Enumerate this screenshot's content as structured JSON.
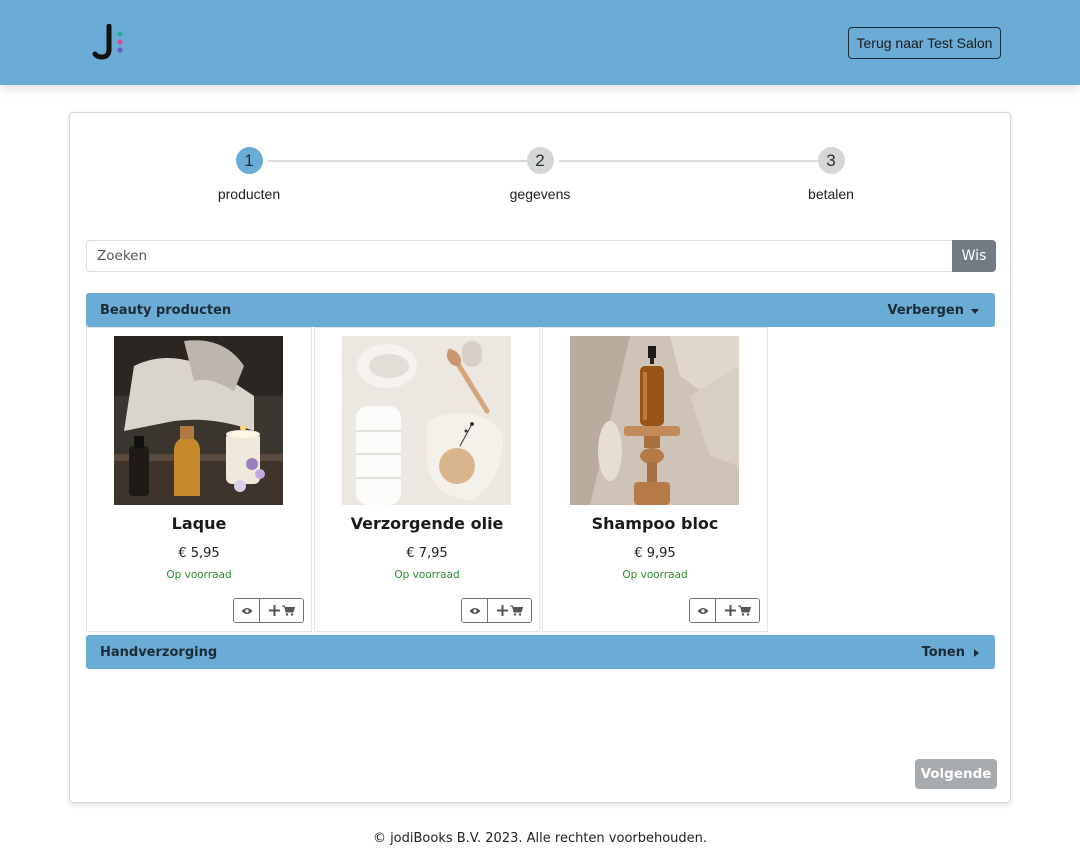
{
  "header": {
    "logo_icon": "jodibooks-logo-icon",
    "back_button_label": "Terug naar Test Salon",
    "bar_color": "#6aacd6"
  },
  "steps": [
    {
      "number": "1",
      "label": "producten",
      "active": true
    },
    {
      "number": "2",
      "label": "gegevens",
      "active": false
    },
    {
      "number": "3",
      "label": "betalen",
      "active": false
    }
  ],
  "search": {
    "placeholder": "Zoeken",
    "value": "",
    "clear_label": "Wis"
  },
  "categories": [
    {
      "title": "Beauty producten",
      "toggle_label": "Verbergen",
      "expanded": true,
      "products": [
        {
          "name": "Laque",
          "price": "€ 5,95",
          "stock": "Op voorraad",
          "image": "oil-bottles-candle-photo"
        },
        {
          "name": "Verzorgende olie",
          "price": "€ 7,95",
          "stock": "Op voorraad",
          "image": "towel-brush-soap-photo"
        },
        {
          "name": "Shampoo bloc",
          "price": "€ 9,95",
          "stock": "Op voorraad",
          "image": "amber-dropper-bottle-photo"
        }
      ]
    },
    {
      "title": "Handverzorging",
      "toggle_label": "Tonen",
      "expanded": false,
      "products": []
    }
  ],
  "actions": {
    "view_icon": "eye-icon",
    "add_icons": [
      "plus-icon",
      "cart-icon"
    ],
    "next_label": "Volgende"
  },
  "footer": {
    "text": "© jodiBooks B.V. 2023. Alle rechten voorbehouden."
  },
  "colors": {
    "accent": "#6aacd6",
    "stock_green": "#2f8a2f",
    "search_clear_bg": "#727b84",
    "next_button_bg": "#a7abae"
  }
}
